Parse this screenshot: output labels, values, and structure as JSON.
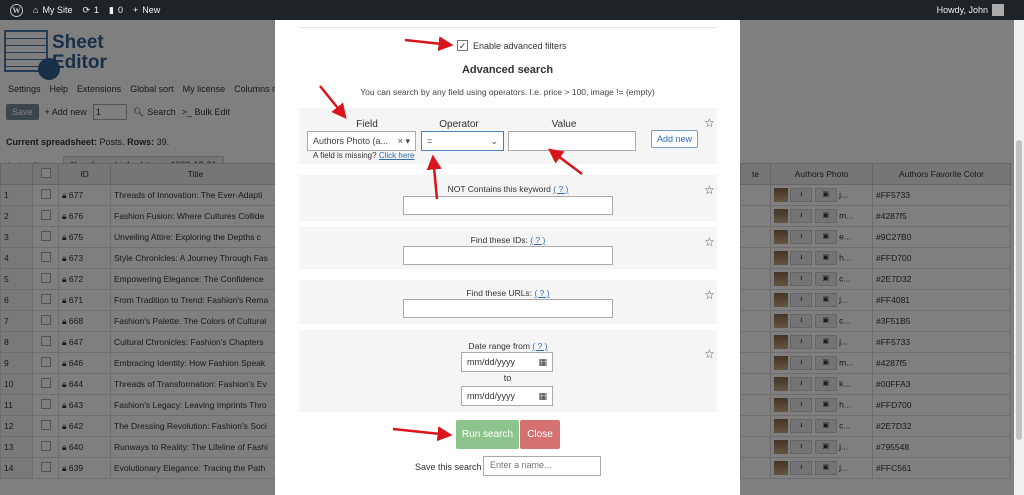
{
  "adminbar": {
    "site": "My Site",
    "updates": "1",
    "comments": "0",
    "new": "New",
    "howdy": "Howdy, John"
  },
  "app": {
    "logo": {
      "line1": "Sheet",
      "line2": "Editor"
    },
    "menu": [
      "Settings",
      "Help",
      "Extensions",
      "Global sort",
      "My license",
      "Columns m"
    ],
    "toolbar": {
      "save": "Save",
      "add_new": "+ Add new",
      "add_count": "1",
      "search": "Search",
      "bulk_edit": ">_ Bulk Edit"
    },
    "current_label": "Current spreadsheet:",
    "current_value": "Posts.",
    "rows_label": "Rows:",
    "rows_value": "39.",
    "active_filters_label": "Active filters:",
    "filter_chip": "✖ authors_birth_date <= 1999-12-31"
  },
  "table": {
    "headers": {
      "id": "ID",
      "title": "Title",
      "status_tail": "te",
      "photo": "Authors Photo",
      "color": "Authors Favorite Color"
    },
    "rows": [
      {
        "n": "1",
        "id": "677",
        "title": "Threads of Innovation: The Ever-Adapti",
        "initial": "j...",
        "color": "#FF5733"
      },
      {
        "n": "2",
        "id": "676",
        "title": "Fashion Fusion: Where Cultures Collide",
        "initial": "m...",
        "color": "#4287f5"
      },
      {
        "n": "3",
        "id": "675",
        "title": "Unveiling Attire: Exploring the Depths c",
        "initial": "e...",
        "color": "#9C27B0"
      },
      {
        "n": "4",
        "id": "673",
        "title": "Style Chronicles: A Journey Through Fas",
        "initial": "h...",
        "color": "#FFD700"
      },
      {
        "n": "5",
        "id": "672",
        "title": "Empowering Elegance: The Confidence",
        "initial": "c...",
        "color": "#2E7D32"
      },
      {
        "n": "6",
        "id": "671",
        "title": "From Tradition to Trend: Fashion's Rema",
        "initial": "j...",
        "color": "#FF4081"
      },
      {
        "n": "7",
        "id": "668",
        "title": "Fashion's Palette: The Colors of Cultural",
        "initial": "c...",
        "color": "#3F51B5"
      },
      {
        "n": "8",
        "id": "647",
        "title": "Cultural Chronicles: Fashion's Chapters",
        "initial": "j...",
        "color": "#FF5733"
      },
      {
        "n": "9",
        "id": "646",
        "title": "Embracing Identity: How Fashion Speak",
        "initial": "m...",
        "color": "#4287f5"
      },
      {
        "n": "10",
        "id": "644",
        "title": "Threads of Transformation: Fashion's Ev",
        "initial": "k...",
        "color": "#00FFA3"
      },
      {
        "n": "11",
        "id": "643",
        "title": "Fashion's Legacy: Leaving Imprints Thro",
        "initial": "h...",
        "color": "#FFD700"
      },
      {
        "n": "12",
        "id": "642",
        "title": "The Dressing Revolution: Fashion's Soci",
        "initial": "c...",
        "color": "#2E7D32"
      },
      {
        "n": "13",
        "id": "640",
        "title": "Runways to Reality: The Lifeline of Fashi",
        "initial": "j...",
        "color": "#795548"
      },
      {
        "n": "14",
        "id": "639",
        "title": "Evolutionary Elegance: Tracing the Path",
        "initial": "j...",
        "color": "#FFC561"
      }
    ]
  },
  "modal": {
    "enable_label": "Enable advanced filters",
    "title": "Advanced search",
    "description": "You can search by any field using operators. I.e. price > 100, image != (empty)",
    "field_label": "Field",
    "operator_label": "Operator",
    "value_label": "Value",
    "field_value": "Authors Photo (a...",
    "operator_value": "=",
    "add_new": "Add new",
    "missing_text": "A field is missing?",
    "missing_link": "Click here",
    "not_contains_label": "NOT Contains this keyword",
    "help_mark": "( ? )",
    "ids_label": "Find these IDs:",
    "urls_label": "Find these URLs:",
    "date_label": "Date range from",
    "date_placeholder": "mm/dd/yyyy",
    "to_label": "to",
    "run": "Run search",
    "close": "Close",
    "save_label": "Save this search",
    "save_placeholder": "Enter a name..."
  },
  "colors": {
    "arrow": "#d9151b",
    "run": "#8cc48c",
    "close": "#d47272",
    "adminbar": "#1d2327"
  }
}
